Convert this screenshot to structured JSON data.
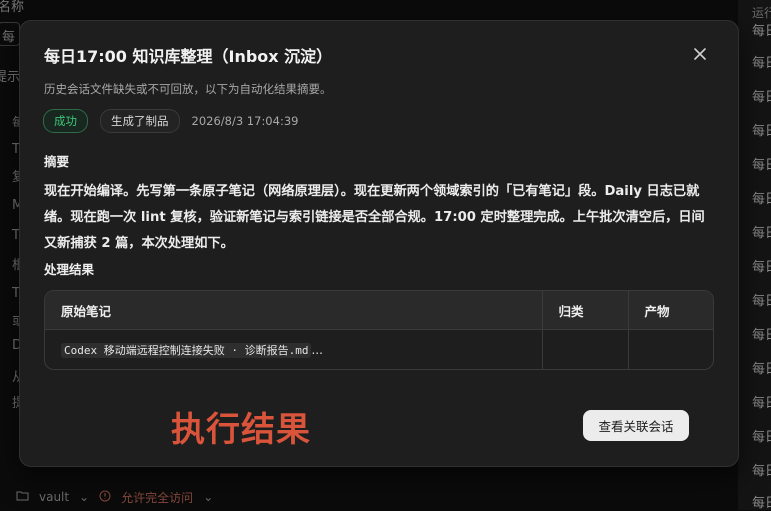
{
  "background": {
    "left_fragments": [
      "名称",
      "每",
      "提示",
      "每",
      "T",
      "复",
      "M",
      "T",
      "根",
      "T",
      "或",
      "D",
      "从",
      "提"
    ],
    "right_header": "运行",
    "right_items": [
      "每日",
      "每日",
      "每日",
      "每日",
      "每日",
      "每日",
      "每日",
      "每日",
      "每日",
      "每日",
      "每日",
      "每日",
      "每日",
      "每日",
      "每日"
    ],
    "footer": {
      "vault_label": "vault",
      "access_label": "允许完全访问"
    }
  },
  "modal": {
    "title": "每日17:00 知识库整理（Inbox 沉淀）",
    "subtitle": "历史会话文件缺失或不可回放，以下为自动化结果摘要。",
    "status_badge": "成功",
    "artifact_badge": "生成了制品",
    "timestamp": "2026/8/3 17:04:39",
    "summary_heading": "摘要",
    "summary_text": "现在开始编译。先写第一条原子笔记（网络原理层）。现在更新两个领域索引的「已有笔记」段。Daily 日志已就绪。现在跑一次 lint 复核，验证新笔记与索引链接是否全部合规。17:00 定时整理完成。上午批次清空后，日间又新捕获 2 篇，本次处理如下。",
    "results_heading": "处理结果",
    "table": {
      "headers": [
        "原始笔记",
        "归类",
        "产物"
      ],
      "rows": [
        {
          "note_code": "Codex 移动端远程控制连接失败 · 诊断报告.md",
          "note_suffix": "...",
          "category": "",
          "artifact": ""
        }
      ]
    },
    "result_label": "执行结果",
    "view_button": "查看关联会话"
  },
  "colors": {
    "accent_success": "#3fc47a",
    "result_label": "#d9543a",
    "modal_bg": "#1e1e1e"
  }
}
